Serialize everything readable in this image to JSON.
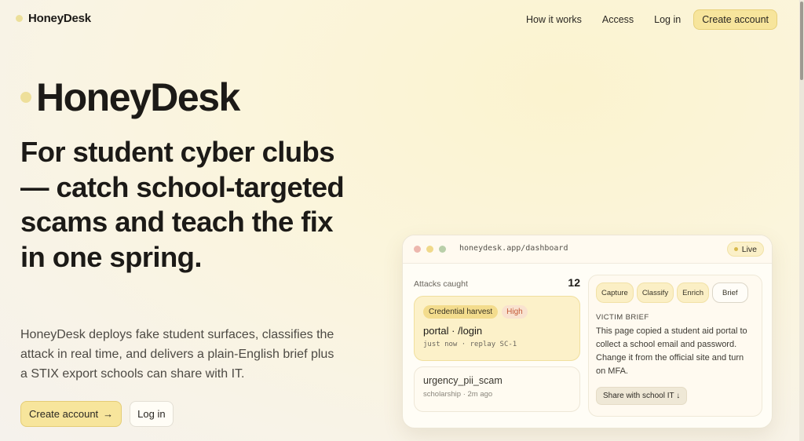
{
  "brand": {
    "name": "HoneyDesk"
  },
  "nav": {
    "links": [
      "How it works",
      "Access",
      "Log in"
    ],
    "cta": "Create account"
  },
  "hero": {
    "title": "HoneyDesk",
    "headline": "For student cyber clubs — catch school-targeted scams and teach the fix in one spring.",
    "lede": "HoneyDesk deploys fake student surfaces, classifies the attack in real time, and delivers a plain-English brief plus a STIX export schools can share with IT.",
    "primary_cta": "Create account",
    "primary_cta_icon": "→",
    "secondary_cta": "Log in"
  },
  "dashboard": {
    "url": "honeydesk.app/dashboard",
    "status": "Live",
    "attacks_label": "Attacks caught",
    "attacks_count": "12",
    "alerts": [
      {
        "type": "Credential harvest",
        "severity": "High",
        "title": "portal · /login",
        "meta": "just now · replay SC-1"
      },
      {
        "title": "urgency_pii_scam",
        "meta": "scholarship · 2m ago"
      }
    ],
    "stages": [
      "Capture",
      "Classify",
      "Enrich",
      "Brief"
    ],
    "brief_label": "VICTIM BRIEF",
    "brief_text": "This page copied a student aid portal to collect a school email and password. Change it from the official site and turn on MFA.",
    "share_button": "Share with school IT ↓"
  },
  "colors": {
    "accent": "#f7e59c",
    "accent_border": "#e4cc75",
    "severity_high": "#c45a3a",
    "text": "#1c1a17"
  }
}
